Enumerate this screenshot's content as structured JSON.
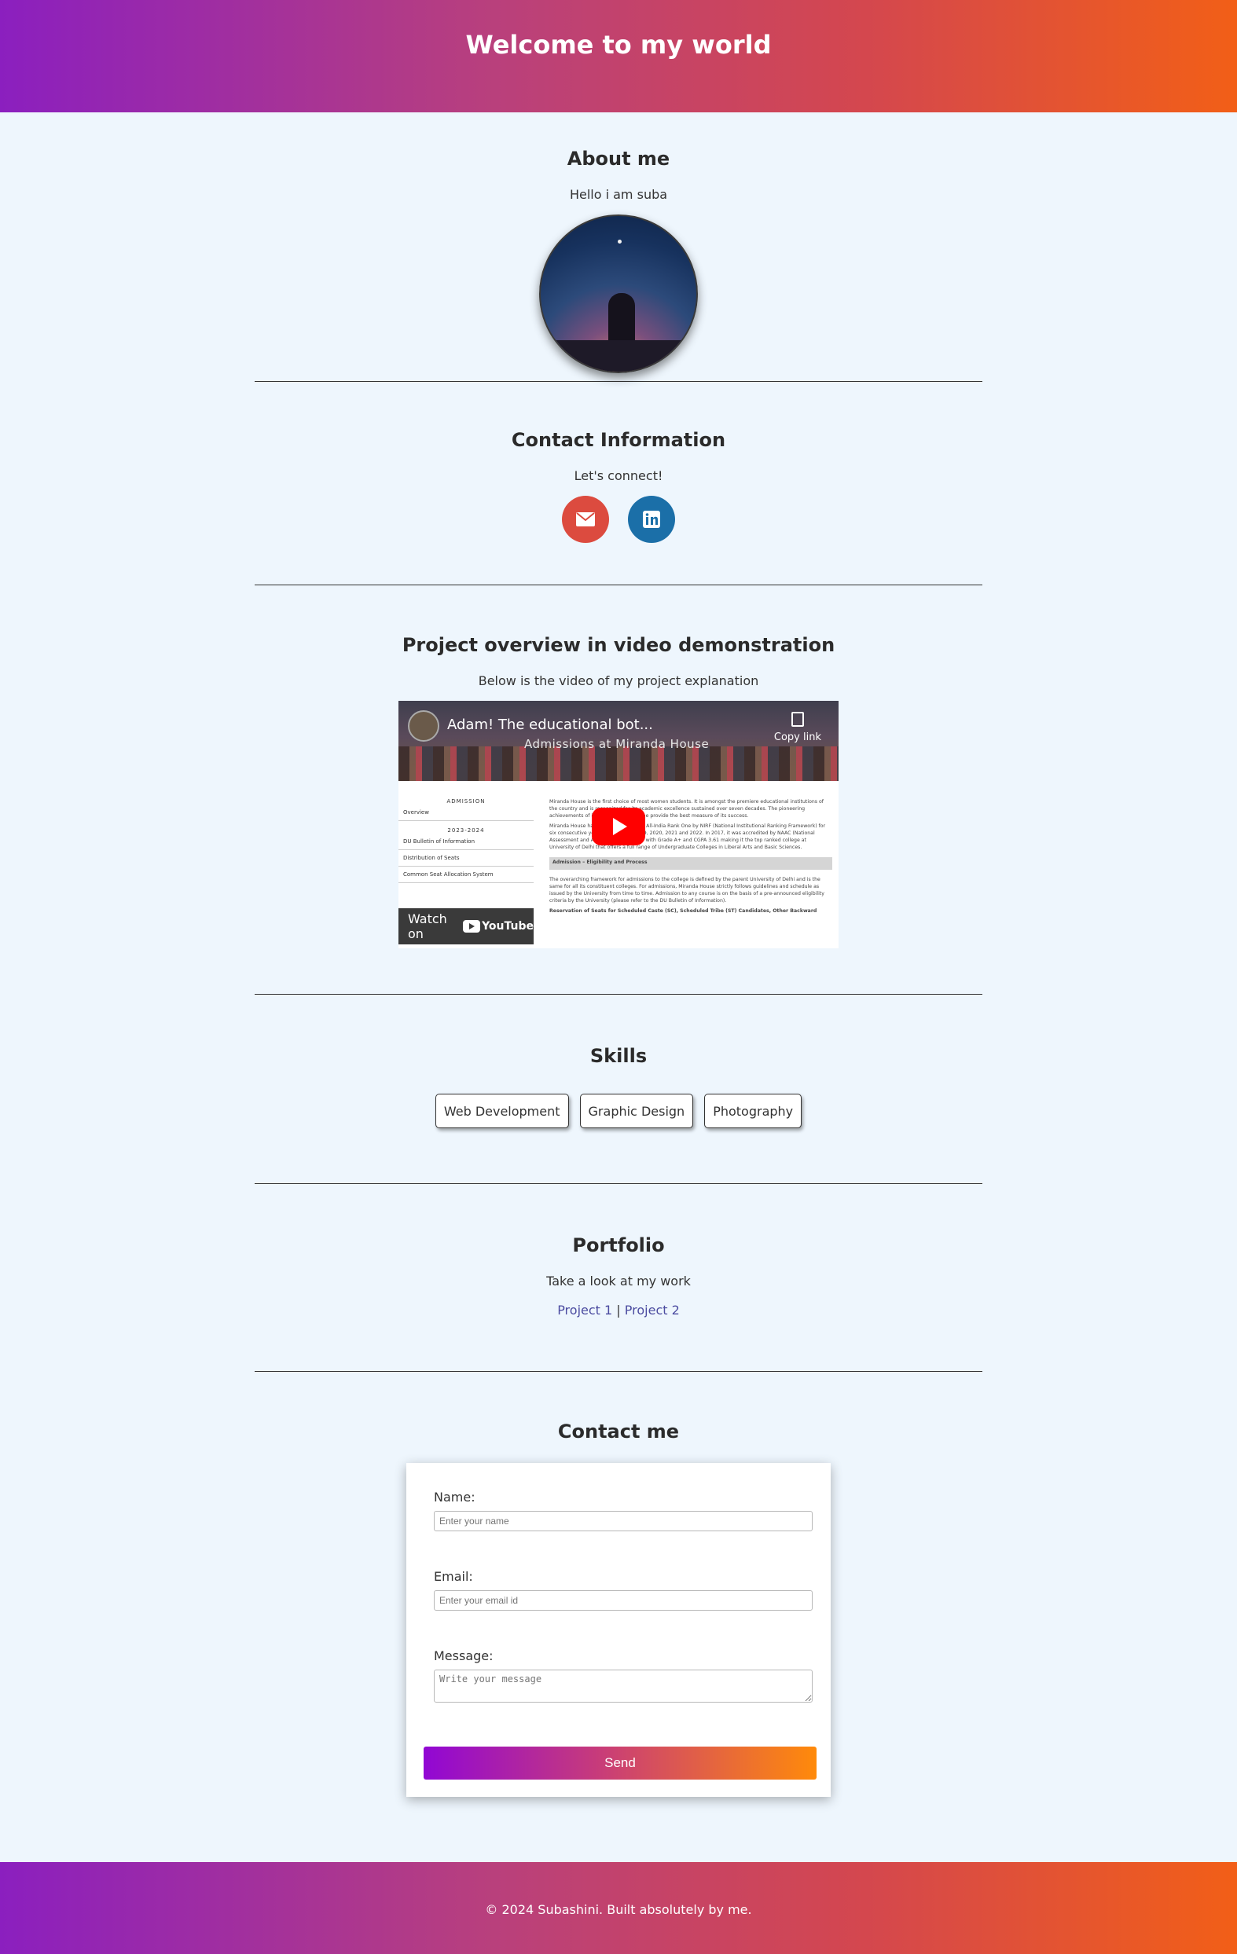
{
  "header": {
    "title": "Welcome to my world"
  },
  "about": {
    "heading": "About me",
    "text": "Hello i am suba"
  },
  "contact_info": {
    "heading": "Contact Information",
    "text": "Let's connect!",
    "icons": [
      "envelope-icon",
      "linkedin-icon"
    ],
    "colors": {
      "email": "#dc4b3f",
      "linkedin": "#1b6fa8"
    }
  },
  "video": {
    "heading": "Project overview in video demonstration",
    "text": "Below is the video of my project explanation",
    "embed": {
      "title": "Adam! The educational bot...",
      "subtitle": "Admissions at Miranda House",
      "copy_label": "Copy link",
      "watch_label": "Watch on",
      "yt_label": "YouTube",
      "left_panel": {
        "title": "ADMISSION",
        "overview": "Overview",
        "year": "2023-2024",
        "rows": [
          "DU Bulletin of Information",
          "Distribution of Seats",
          "Common Seat Allocation System"
        ]
      },
      "right_panel": {
        "para1": "Miranda House is the first choice of most women students. It is amongst the premiere educational institutions of the country and is recognized for its academic excellence sustained over seven decades. The pioneering achievements of its faculty and alumnae provide the best measure of its success.",
        "para2": "Miranda House has been ranked as the All-India Rank One by NIRF (National Institutional Ranking Framework) for six consecutive years 2017, 2018, 2019, 2020, 2021 and 2022. In 2017, it was accredited by NAAC (National Assessment and Accreditation Council) with Grade A+ and CGPA 3.61 making it the top ranked college at University of Delhi that offers a full range of Undergraduate Colleges in Liberal Arts and Basic Sciences.",
        "bar": "Admission – Eligibility and Process",
        "para3": "The overarching framework for admissions to the college is defined by the parent University of Delhi and is the same for all its constituent colleges. For admissions, Miranda House strictly follows guidelines and schedule as issued by the University from time to time. Admission to any course is on the basis of a pre-announced eligibility criteria by the University (please refer to the DU Bulletin of Information).",
        "para4": "Reservation of Seats for Scheduled Caste (SC), Scheduled Tribe (ST) Candidates, Other Backward"
      }
    }
  },
  "skills": {
    "heading": "Skills",
    "items": [
      "Web Development",
      "Graphic Design",
      "Photography"
    ]
  },
  "portfolio": {
    "heading": "Portfolio",
    "text": "Take a look at my work",
    "link1": "Project 1",
    "separator": "|",
    "link2": "Project 2"
  },
  "contact_form": {
    "heading": "Contact me",
    "name_label": "Name:",
    "name_placeholder": "Enter your name",
    "email_label": "Email:",
    "email_placeholder": "Enter your email id",
    "message_label": "Message:",
    "message_placeholder": "Write your message",
    "send_label": "Send"
  },
  "footer": {
    "text": "© 2024 Subashini. Built absolutely by me."
  }
}
